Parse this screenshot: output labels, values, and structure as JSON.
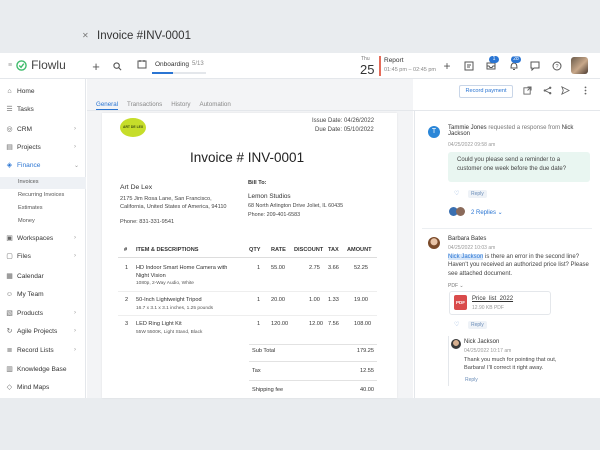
{
  "app": {
    "name": "Flowlu"
  },
  "topbar": {
    "onboarding_label": "Onboarding",
    "onboarding_count": "5/13",
    "onboarding_progress": 0.38,
    "calendar_day": "Thu",
    "calendar_date": "25",
    "event_title": "Report",
    "event_time": "01:45 pm – 02:45 pm",
    "badge_tasks": "1",
    "badge_notifications": "28"
  },
  "sidebar": {
    "items": [
      {
        "label": "Home"
      },
      {
        "label": "Tasks"
      },
      {
        "label": "CRM"
      },
      {
        "label": "Projects"
      },
      {
        "label": "Finance"
      },
      {
        "label": "Workspaces"
      },
      {
        "label": "Files"
      },
      {
        "label": "Calendar"
      },
      {
        "label": "My Team"
      },
      {
        "label": "Products"
      },
      {
        "label": "Agile Projects"
      },
      {
        "label": "Record Lists"
      },
      {
        "label": "Knowledge Base"
      },
      {
        "label": "Mind Maps"
      }
    ],
    "finance_sub": [
      "Invoices",
      "Recurring Invoices",
      "Estimates",
      "Money"
    ]
  },
  "header": {
    "title": "Invoice #INV-0001",
    "record_payment": "Record payment",
    "tabs": [
      "General",
      "Transactions",
      "History",
      "Automation"
    ]
  },
  "invoice": {
    "logo_text": "ART DE LEX",
    "issue_date_label": "Issue Date:",
    "issue_date": "04/26/2022",
    "due_date_label": "Due Date:",
    "due_date": "05/10/2022",
    "heading": "Invoice # INV-0001",
    "from_name": "Art De Lex",
    "from_address": "2175 Jim Rosa Lane, San Francisco, California, United States of America, 94110",
    "from_phone": "Phone: 831-331-9541",
    "bill_to_label": "Bill To:",
    "bill_name": "Lemon Studios",
    "bill_address": "68 North Arlington Drive Joliet, IL 60435",
    "bill_phone": "Phone: 209-401-6583",
    "columns": [
      "#",
      "ITEM & DESCRIPTIONS",
      "QTY",
      "RATE",
      "DISCOUNT",
      "TAX",
      "AMOUNT"
    ],
    "rows": [
      {
        "n": "1",
        "item": "HD Indoor Smart Home Camera with Night Vision",
        "desc": "1080p, 2-Way Audio, White",
        "qty": "1",
        "rate": "55.00",
        "discount": "2.75",
        "tax": "3.66",
        "amount": "52.25"
      },
      {
        "n": "2",
        "item": "50-Inch Lightweight Tripod",
        "desc": "16.7 x 3.1 x 3.1 inches, 1.25 pounds",
        "qty": "1",
        "rate": "20.00",
        "discount": "1.00",
        "tax": "1.33",
        "amount": "19.00"
      },
      {
        "n": "3",
        "item": "LED Ring Light Kit",
        "desc": "55W 5500K, Light Stand, Black",
        "qty": "1",
        "rate": "120.00",
        "discount": "12.00",
        "tax": "7.56",
        "amount": "108.00"
      }
    ],
    "subtotal_label": "Sub Total",
    "subtotal": "179.25",
    "tax_label": "Tax",
    "tax": "12.55",
    "shipping_label": "Shipping fee",
    "shipping": "40.00"
  },
  "comments": {
    "c1_name": "Tammie Jones",
    "c1_action": "requested a response from",
    "c1_target": "Nick Jackson",
    "c1_time": "04/25/2022 09:58 am",
    "c1_text": "Could you please send a reminder to a customer one week before the due date?",
    "reply_label": "Reply",
    "replies_label": "2 Replies",
    "c2_name": "Barbara Bates",
    "c2_time": "04/25/2022 10:03 am",
    "c2_mention": "Nick Jackson",
    "c2_text": "is there an error in the second line? Haven't you received an authorized price list? Please see attached document.",
    "pdf_label": "PDF",
    "file_name": "Price_list_2022",
    "file_size": "12.90 KB PDF",
    "c3_name": "Nick Jackson",
    "c3_time": "04/25/2022 10:17 am",
    "c3_text": "Thank you much for pointing that out, Barbara! I'll correct it right away."
  },
  "colors": {
    "accent": "#2a75d3",
    "brand_green": "#3dbb6a",
    "bubble": "#e9f6f1"
  }
}
